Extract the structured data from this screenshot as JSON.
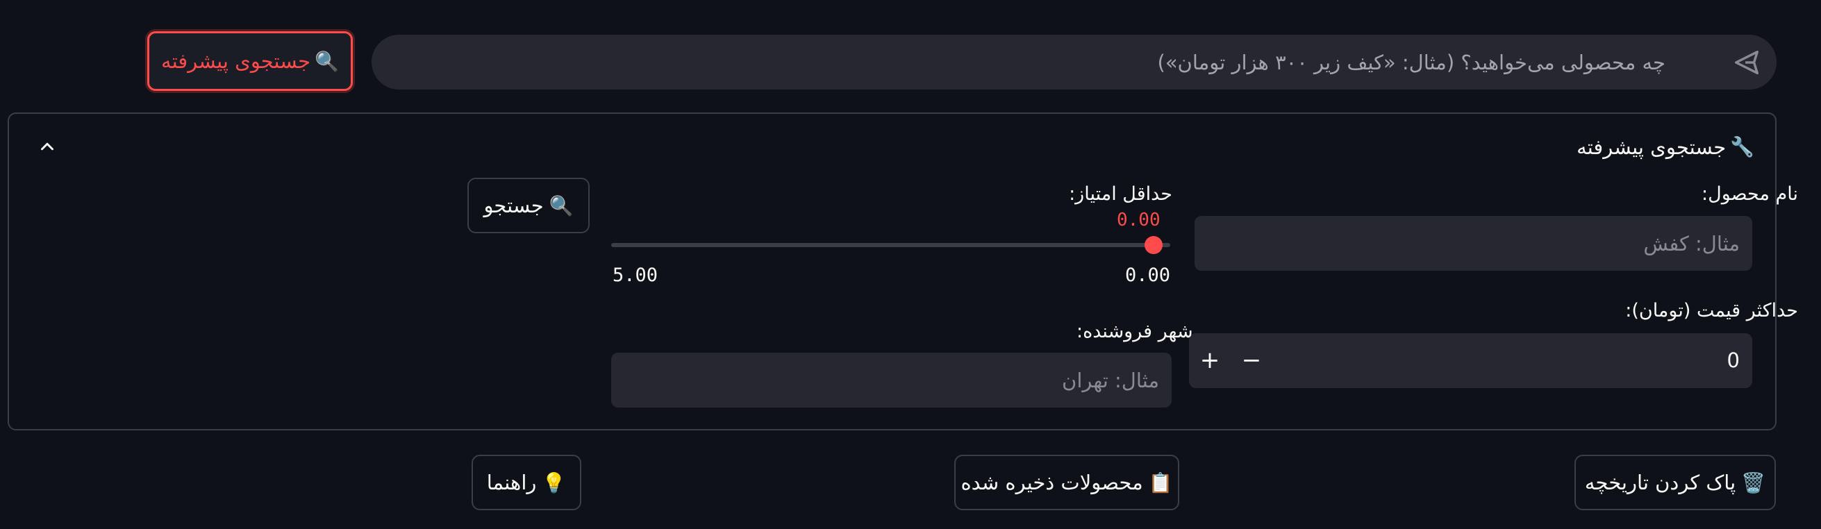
{
  "chat": {
    "placeholder": "چه محصولی می‌خواهید؟ (مثال: «کیف زیر ۳۰۰ هزار تومان»)"
  },
  "advanced_toggle": {
    "icon": "🔍",
    "label": "جستجوی پیشرفته"
  },
  "panel": {
    "title_icon": "🔧",
    "title": "جستجوی پیشرفته",
    "product_name": {
      "label": "نام محصول:",
      "placeholder": "مثال: کفش"
    },
    "max_price": {
      "label": "حداکثر قیمت (تومان):",
      "value": "0",
      "minus": "−",
      "plus": "+"
    },
    "min_rating": {
      "label": "حداقل امتیاز:",
      "value": 0.0,
      "current_text": "0.00",
      "min_text": "0.00",
      "max_text": "5.00",
      "min": 0,
      "max": 5
    },
    "seller_city": {
      "label": "شهر فروشنده:",
      "placeholder": "مثال: تهران"
    },
    "search_button": {
      "icon": "🔍",
      "label": "جستجو"
    }
  },
  "bottom": {
    "clear_history": {
      "icon": "🗑️",
      "label": "پاک کردن تاریخچه"
    },
    "saved_products": {
      "icon": "📋",
      "label": "محصولات ذخیره شده"
    },
    "guide": {
      "icon": "💡",
      "label": "راهنما"
    }
  },
  "colors": {
    "accent": "#ff4b4b",
    "background": "#0e1117",
    "input_bg": "#262730",
    "border": "#3b3e48"
  }
}
